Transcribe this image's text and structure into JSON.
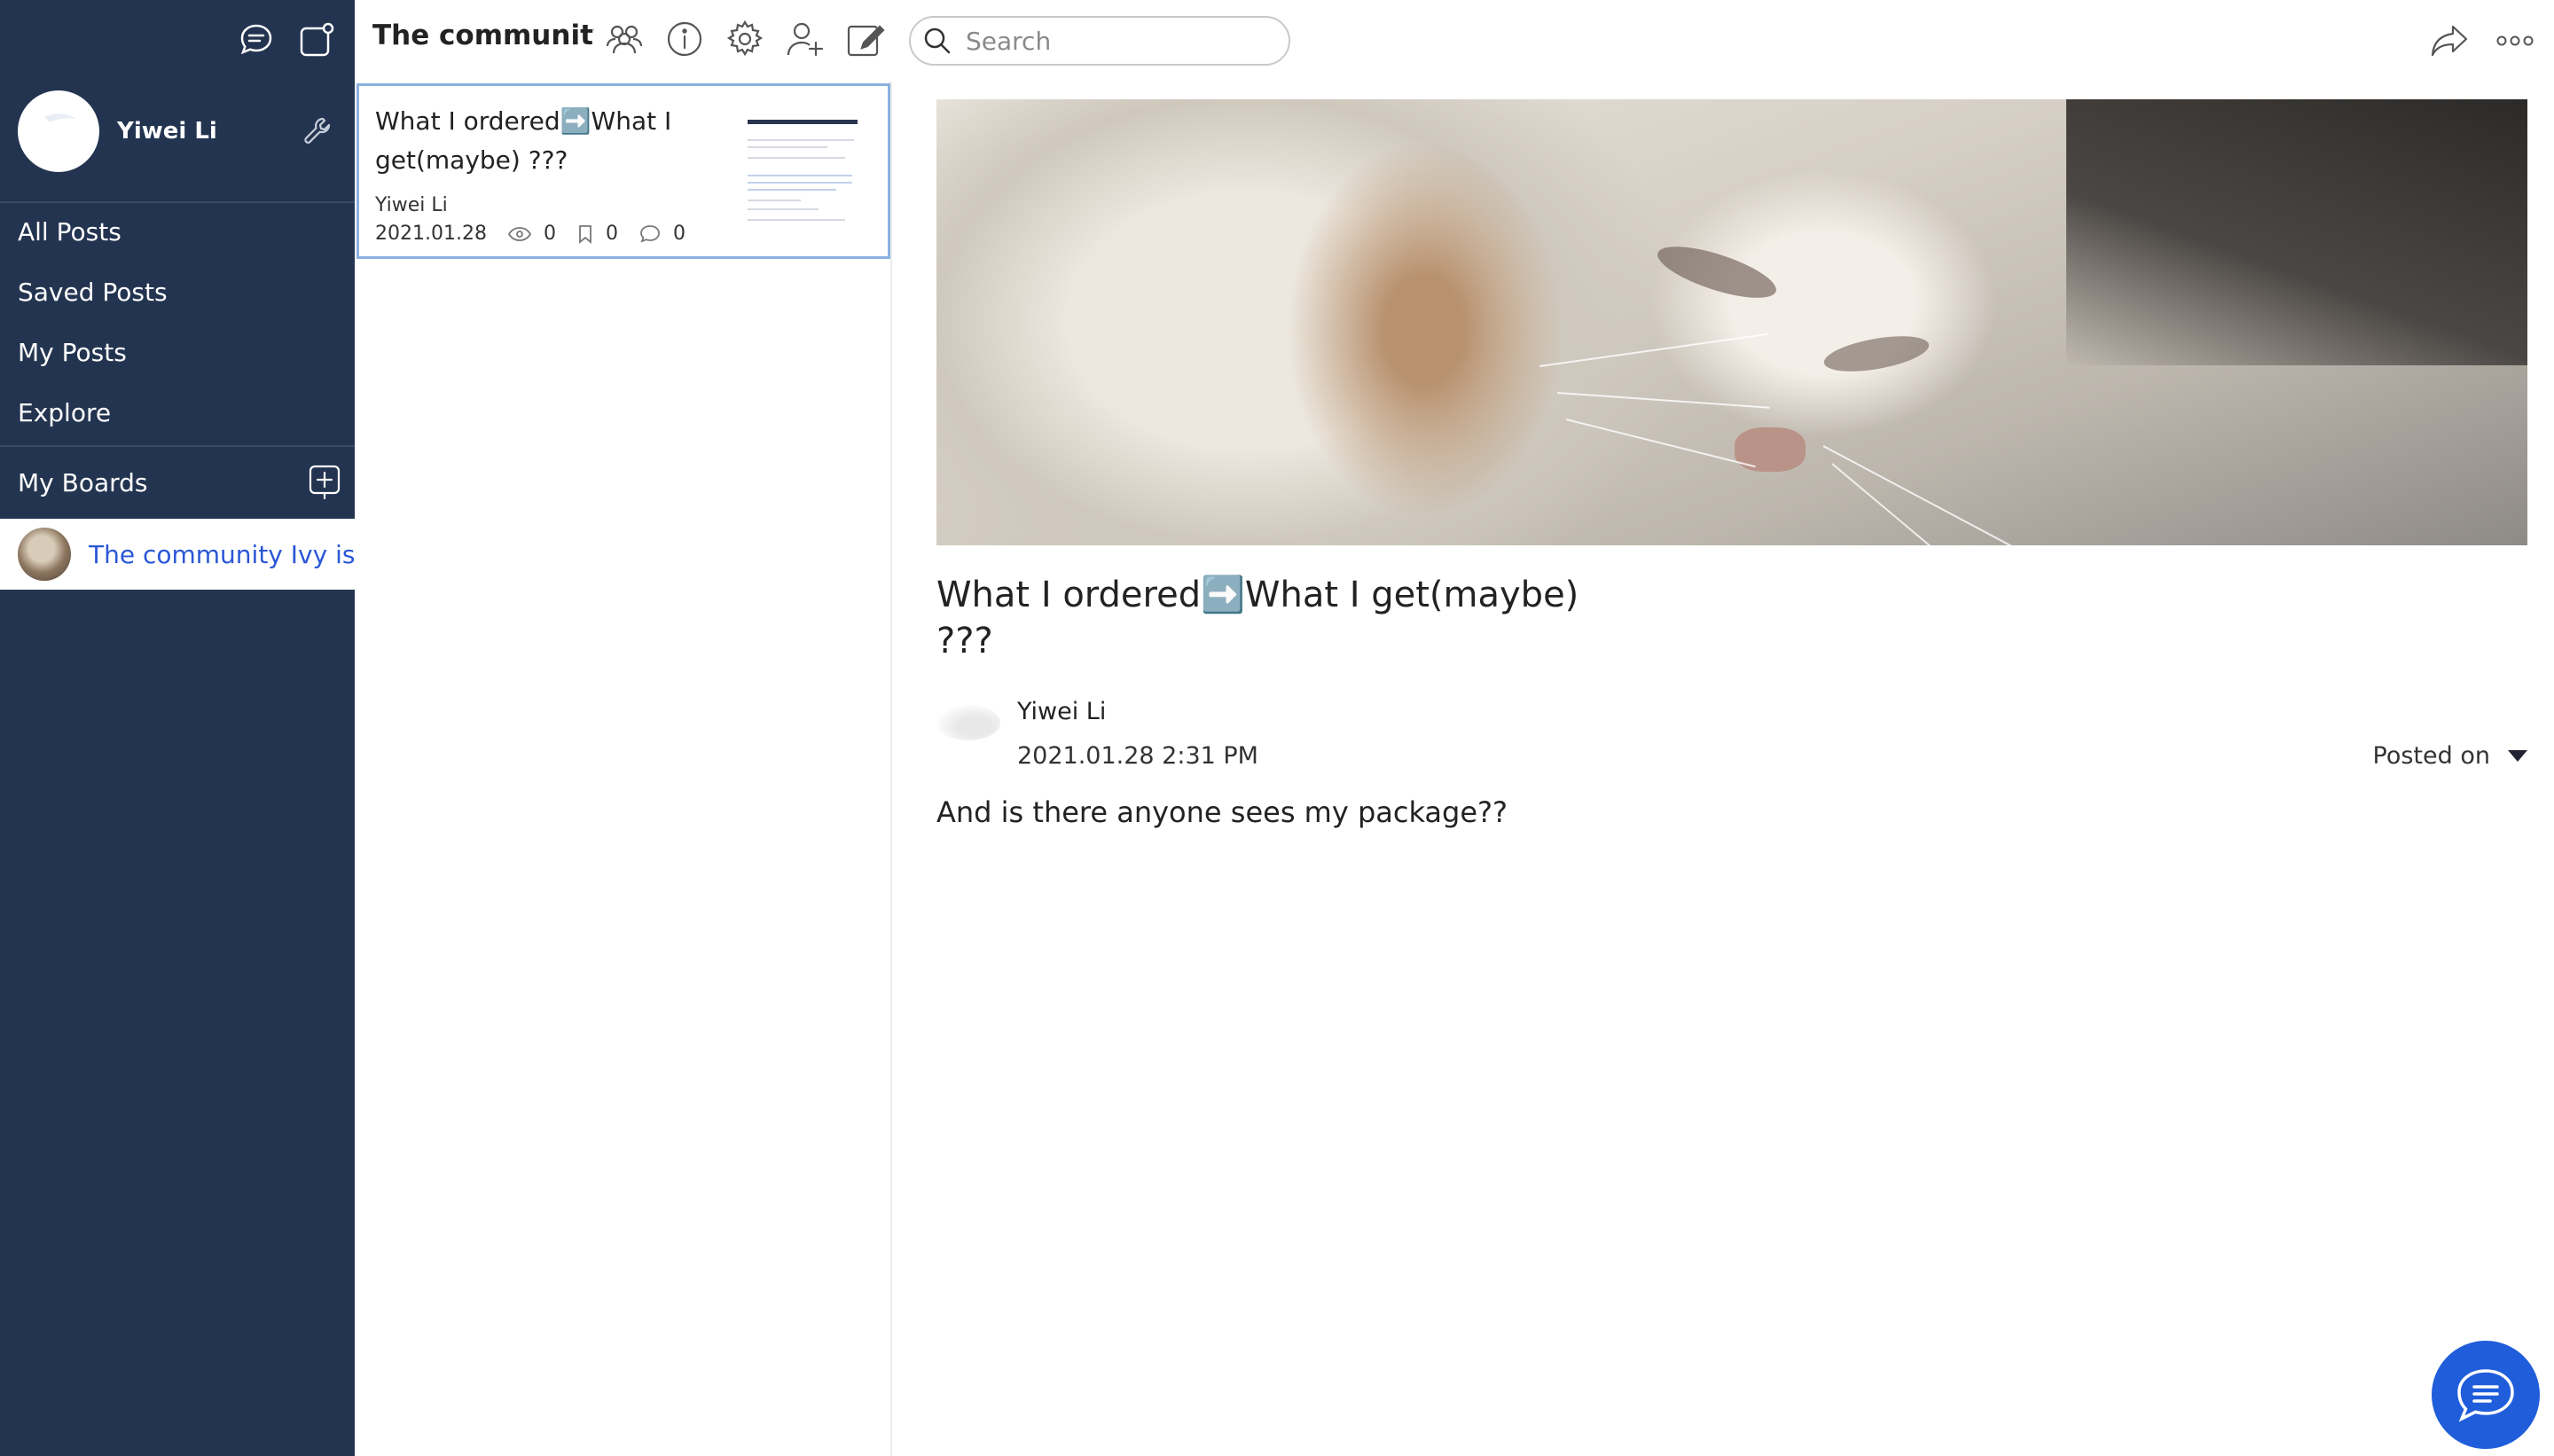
{
  "sidebar": {
    "profile": {
      "name": "Yiwei Li"
    },
    "nav": [
      {
        "label": "All Posts"
      },
      {
        "label": "Saved Posts"
      },
      {
        "label": "My Posts"
      },
      {
        "label": "Explore"
      }
    ],
    "boards_header": "My Boards",
    "boards": [
      {
        "name": "The community Ivy is"
      }
    ]
  },
  "topbar": {
    "title": "The community Ivy is",
    "search_placeholder": "Search",
    "icons": [
      "members-icon",
      "info-icon",
      "settings-icon",
      "add-member-icon",
      "compose-icon"
    ],
    "right_icons": [
      "share-icon",
      "more-icon"
    ]
  },
  "post_list": [
    {
      "title": "What I ordered➡️What I get(maybe) ???",
      "author": "Yiwei Li",
      "date": "2021.01.28",
      "views": "0",
      "saves": "0",
      "comments": "0"
    }
  ],
  "post": {
    "title": "What I ordered➡️What I get(maybe) ???",
    "author": "Yiwei Li",
    "datetime": "2021.01.28 2:31 PM",
    "posted_on_label": "Posted on",
    "body": "And is there anyone sees my package??"
  },
  "colors": {
    "sidebar_bg": "#233450",
    "accent": "#1f5ddb",
    "board_link": "#2a57d6",
    "selected_border": "#8bb0e0"
  }
}
